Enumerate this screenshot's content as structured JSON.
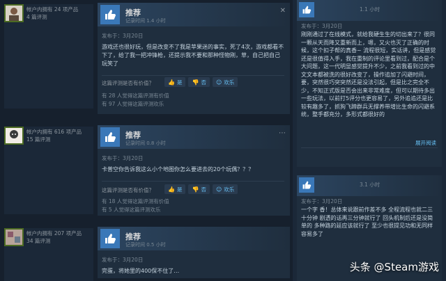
{
  "reviews": [
    {
      "author_meta": [
        "帐户内拥有 24 项产品",
        "4 篇评测"
      ],
      "title": "推荐",
      "hours": "记录时间 1.4 小时",
      "date": "发布于：3月20日",
      "text": "游戏还也很好玩，但是改变不了我是苹果迷的事实，死了4次，游戏都看不下了，给了我一把冲锋枪，还提示我不要和那种怪物刚，草，自己把自己玩笑了",
      "question": "这篇评测是否有价值？",
      "buttons": [
        "是",
        "否",
        "欢乐"
      ],
      "stats": [
        "有 28 人觉得这篇评测有价值",
        "有 97 人觉得这篇评测欢乐"
      ]
    },
    {
      "author_meta": [
        "帐户内拥有 616 项产品",
        "15 篇评测"
      ],
      "title": "推荐",
      "hours": "记录时间 0.8 小时",
      "date": "发布于：3月20日",
      "text": "卡普空你告诉我这么小个地图你怎么要进去的20个玩偶？？？",
      "question": "这篇评测是否有价值？",
      "buttons": [
        "是",
        "否",
        "欢乐"
      ],
      "stats": [
        "有 18 人觉得这篇评测有价值",
        "有 5 人觉得这篇评测欢乐"
      ]
    },
    {
      "author_meta": [
        "帐户内拥有 207 项产品",
        "34 篇评测"
      ],
      "title": "推荐",
      "hours": "记录时间 0.5 小时",
      "date": "发布于：3月20日",
      "text": "完蛋，将她里的400保不住了…"
    }
  ],
  "side_cards": [
    {
      "hours": "1.1 小时",
      "date": "发布于：3月20日",
      "text": "刚刚通过了在线模式，就给我硬生生的切出来了？很同一颗从天而降又重新而上，嗯，又火也灭了正确的时候，这个扣子帮的真香~ 流程很短，实话讲，但是感觉还是很值得入手，我在重制的评论里看到过，配合是个大问题，这一代明显感觉提升不少，之前我看到过的中文文本都被洗的很好改变了，操作追加了闪避时间，要，突然很巧突突然还是没法引起，但是比之完全不少，不知正式版是否会出来非常难度，但可以期待多出一些玩法，以前打5评分也更容易了，另外追追还是比较有趣多了，抓狗飞蹄群兵无撑养带增比生命的闪避系统，整手都充分，多形式都很好的",
      "expand": "展开阅读"
    },
    {
      "hours": "3.1 小时",
      "date": "发布于：3月20日",
      "text": "一个字 香！总体来说跟前作差不多 全程流程也就二三十分钟 剧透的话再三分钟就行了 回头机制后还是没简单的 多种路的延应该就行了 至少也很提见功和无同样容易多了"
    }
  ],
  "watermark": "头条 @Steam游戏",
  "colors": {
    "bg": "#1b2838",
    "panel": "#1f2e3e",
    "accent": "#67c1f5",
    "thumb": "#3a78b8"
  }
}
